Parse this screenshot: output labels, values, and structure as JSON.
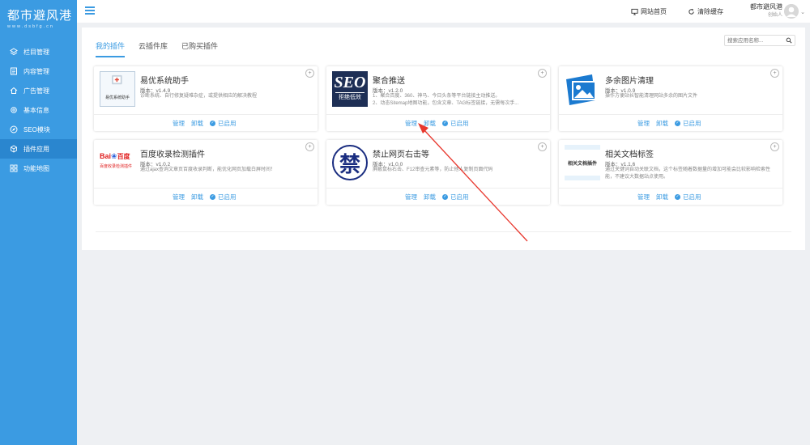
{
  "brand": {
    "name": "都市避风港",
    "url": "www.dsbfg.cn"
  },
  "sidebar": {
    "items": [
      {
        "label": "栏目管理"
      },
      {
        "label": "内容管理"
      },
      {
        "label": "广告管理"
      },
      {
        "label": "基本信息"
      },
      {
        "label": "SEO模块"
      },
      {
        "label": "插件应用"
      },
      {
        "label": "功能地图"
      }
    ]
  },
  "header": {
    "site_home": "网站首页",
    "clear_cache": "清除缓存",
    "user_name": "都市避风港",
    "user_role": "创始人"
  },
  "tabs": [
    {
      "label": "我的插件"
    },
    {
      "label": "云插件库"
    },
    {
      "label": "已购买插件"
    }
  ],
  "search": {
    "placeholder": "搜索应用名称..."
  },
  "plugins": [
    {
      "title": "易优系统助手",
      "version": "版本：v1.4.9",
      "desc": "诊断系统、自行修复疑难杂症，或提供相应的解决教程",
      "thumb_text": "易优系统助手"
    },
    {
      "title": "聚合推送",
      "version": "版本：v1.2.0",
      "desc": "1、聚合百度、360、神马、今日头条等平台链接主动推送。\n2、动态Sitemap地图功能，包含文章、TAG标签链接，无需每次手...",
      "thumb_text": "SEO",
      "thumb_sub": "拒绝低效"
    },
    {
      "title": "多余图片清理",
      "version": "版本：v1.0.9",
      "desc": "操作方便站长智能清理网站多余的图片文件"
    },
    {
      "title": "百度收录检测插件",
      "version": "版本：v1.0.2",
      "desc": "通过ajax查询文章页百度收录判断，能优化网页加载白屏时间！",
      "thumb_text": "Bai",
      "thumb_text2": "百度",
      "thumb_sub": "百度收录检测插件"
    },
    {
      "title": "禁止网页右击等",
      "version": "版本：v1.0.0",
      "desc": "屏蔽鼠标右击、F12审查元素等，防止他人复制页面代码",
      "thumb_text": "禁"
    },
    {
      "title": "相关文档标签",
      "version": "版本：v1.1.6",
      "desc": "通过关键词自动关联文档，这个标签随着数据量的增加可能会比较影响检索性能，不建议大数据站点使用。",
      "thumb_text": "相关文档插件"
    }
  ],
  "actions": {
    "manage": "管理",
    "uninstall": "卸载",
    "enabled": "已启用"
  },
  "colors": {
    "sidebar": "#3b9be2",
    "accent": "#3b9be2",
    "arrow": "#e8382e"
  }
}
